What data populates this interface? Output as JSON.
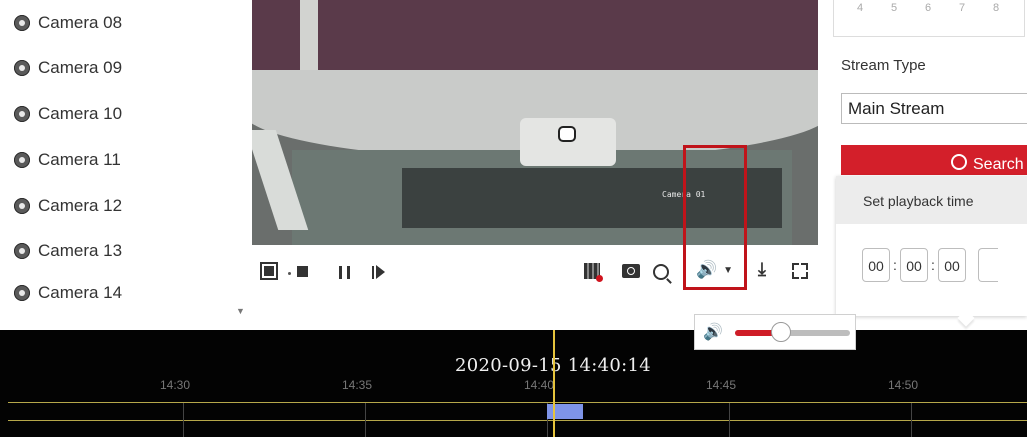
{
  "cameras": [
    "Camera 08",
    "Camera 09",
    "Camera 10",
    "Camera 11",
    "Camera 12",
    "Camera 13",
    "Camera 14"
  ],
  "video": {
    "osd_text": "Camera 01"
  },
  "calendar_partial": [
    "4",
    "5",
    "6",
    "7",
    "8"
  ],
  "stream": {
    "label": "Stream Type",
    "selected": "Main Stream"
  },
  "search": {
    "label": "Search"
  },
  "playback_popup": {
    "title": "Set playback time",
    "hour": "00",
    "minute": "00",
    "second": "00"
  },
  "toolbar": {
    "icons": [
      "split-screen-icon",
      "stop-icon",
      "pause-icon",
      "single-frame-icon",
      "clip-icon",
      "capture-icon",
      "zoom-icon",
      "volume-icon",
      "download-icon",
      "fullscreen-icon"
    ],
    "volume_glyph": "🔊",
    "volume_caret": "▼",
    "download_glyph": "⤓"
  },
  "volume_popup": {
    "level": 0.4,
    "glyph": "🔊"
  },
  "timeline": {
    "datetime": "2020-09-15 14:40:14",
    "ticks": [
      "14:30",
      "14:35",
      "14:40",
      "14:45",
      "14:50"
    ]
  },
  "colors": {
    "accent": "#d31f2a",
    "timeline_bg": "#030303",
    "cursor": "#e5c33c",
    "record": "#7e94e8"
  }
}
